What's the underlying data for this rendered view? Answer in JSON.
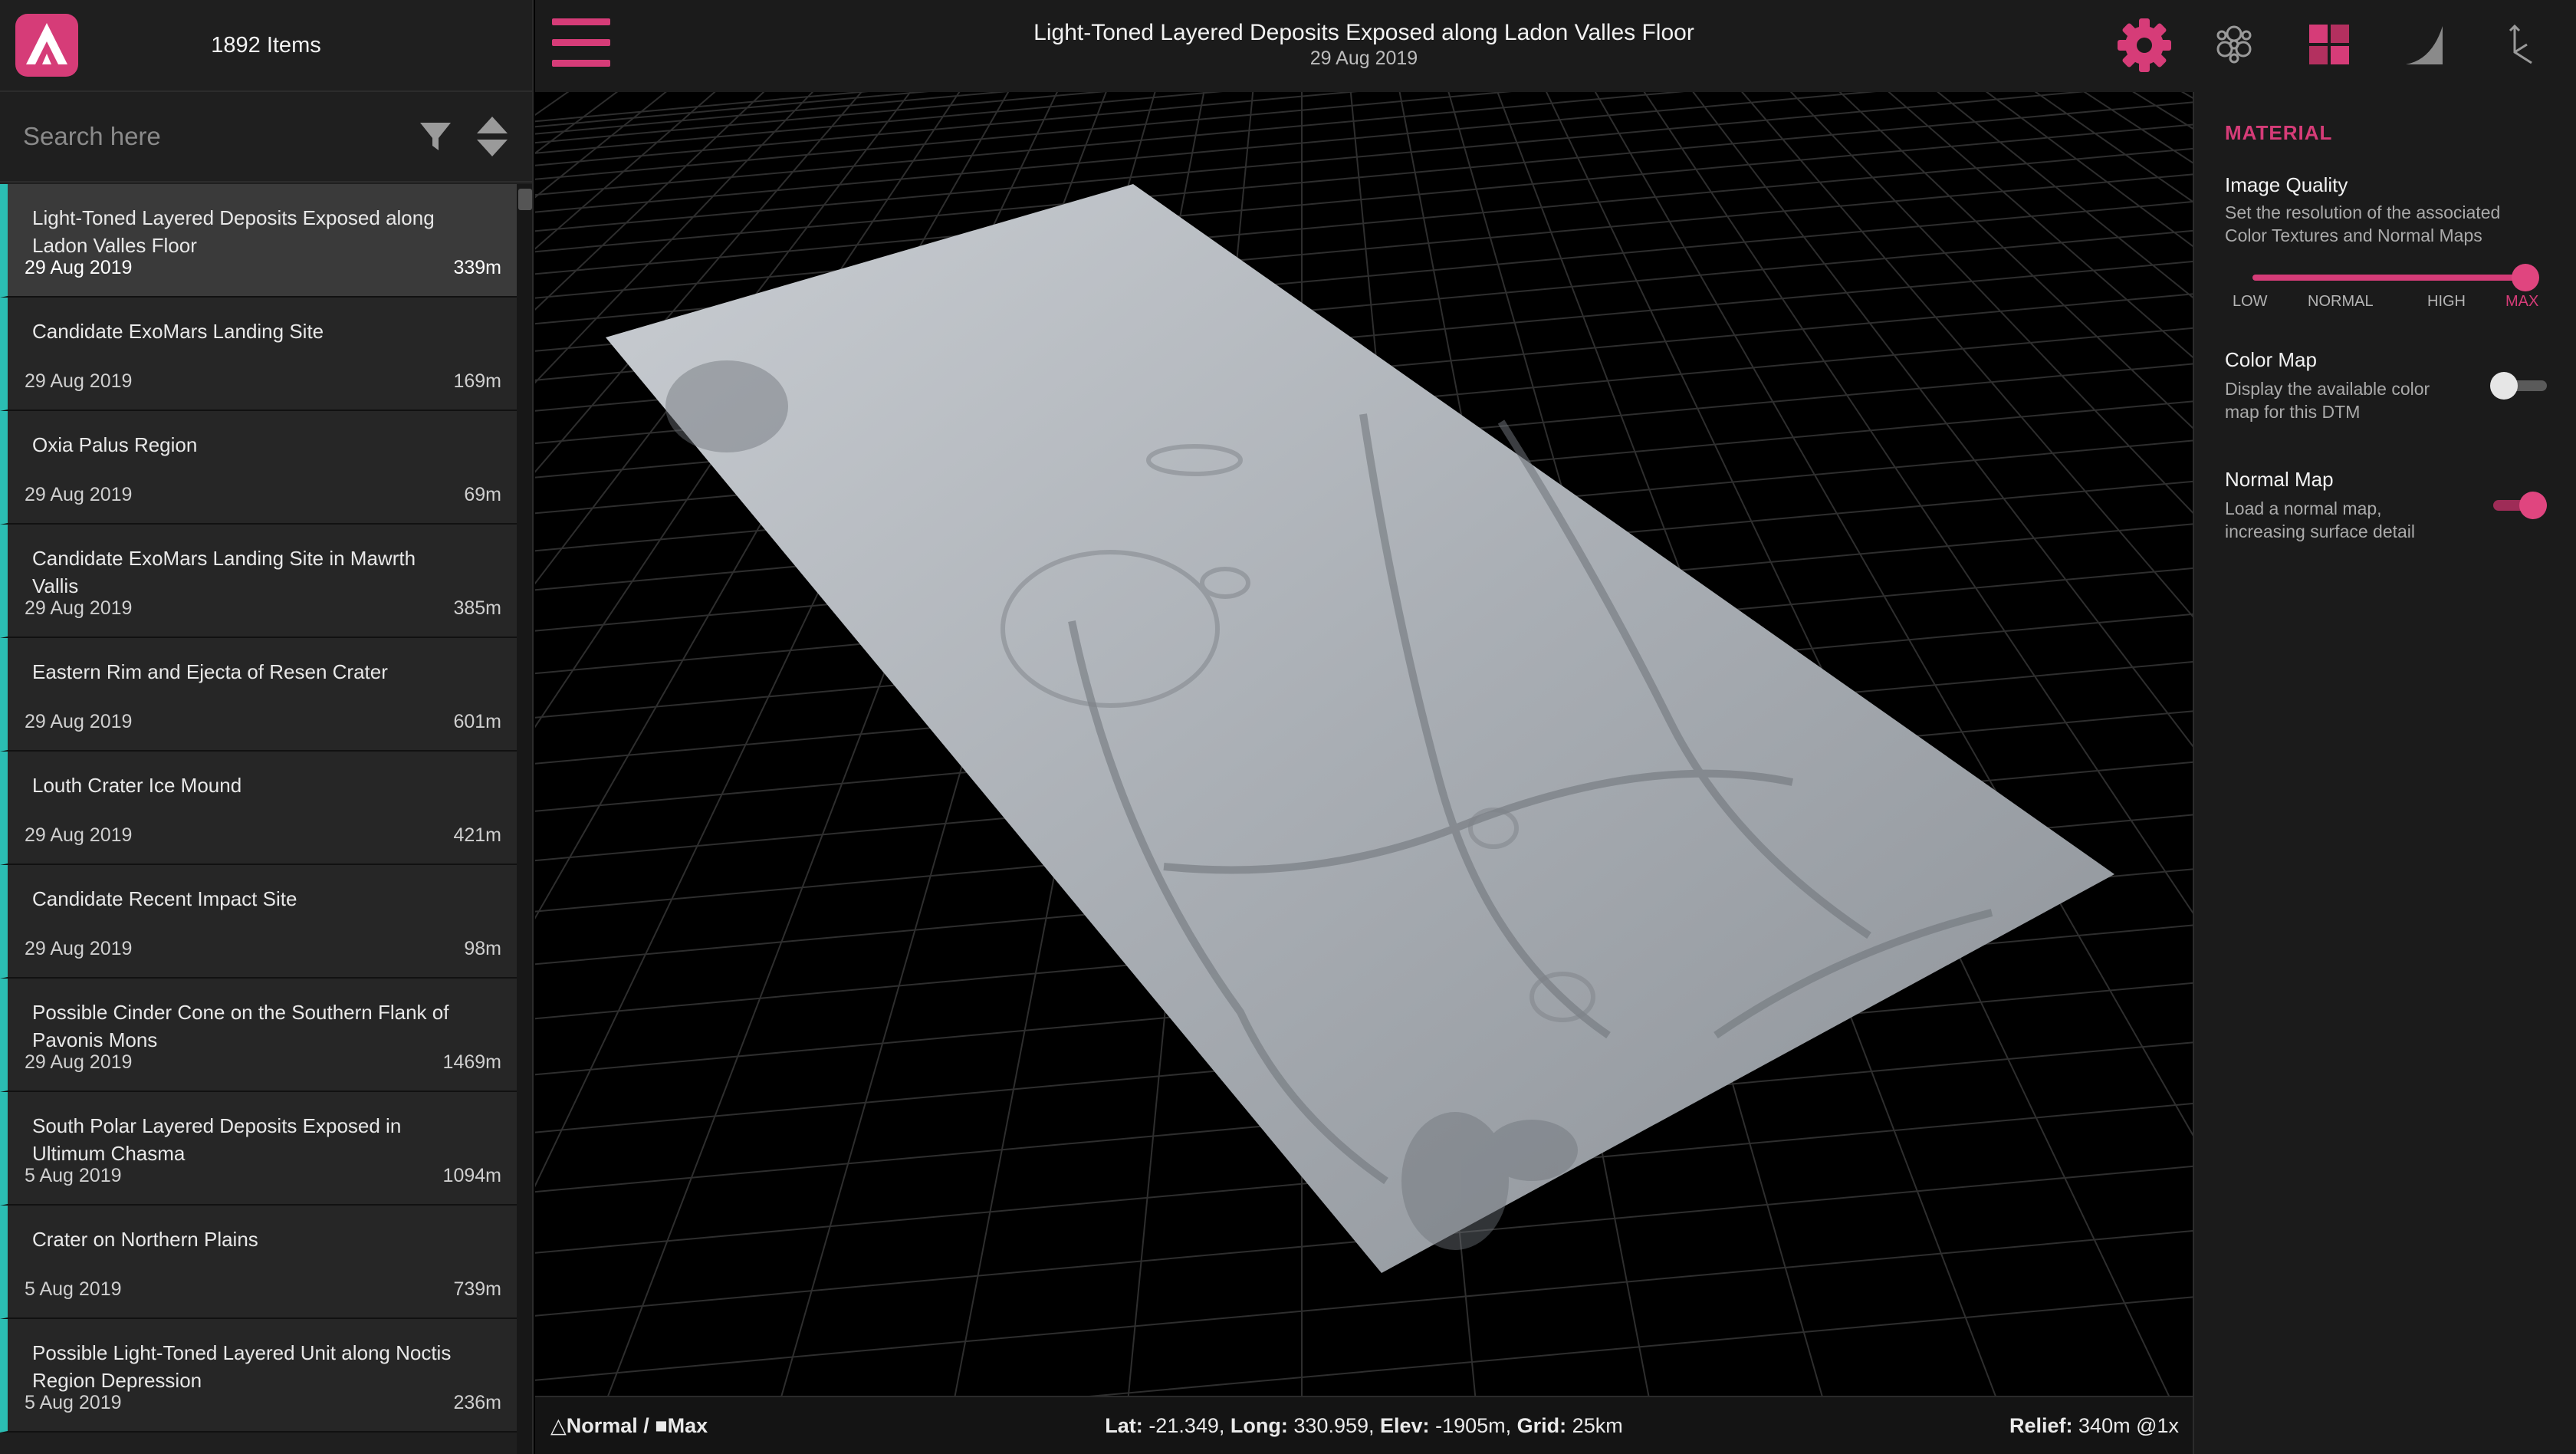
{
  "sidebar": {
    "item_count": "1892 Items",
    "search_placeholder": "Search here",
    "items": [
      {
        "title": "Light-Toned Layered Deposits Exposed along Ladon Valles Floor",
        "date": "29 Aug 2019",
        "size": "339m"
      },
      {
        "title": "Candidate ExoMars Landing Site",
        "date": "29 Aug 2019",
        "size": "169m"
      },
      {
        "title": "Oxia Palus Region",
        "date": "29 Aug 2019",
        "size": "69m"
      },
      {
        "title": "Candidate ExoMars Landing Site in Mawrth Vallis",
        "date": "29 Aug 2019",
        "size": "385m"
      },
      {
        "title": "Eastern Rim and Ejecta of Resen Crater",
        "date": "29 Aug 2019",
        "size": "601m"
      },
      {
        "title": "Louth Crater Ice Mound",
        "date": "29 Aug 2019",
        "size": "421m"
      },
      {
        "title": "Candidate Recent Impact Site",
        "date": "29 Aug 2019",
        "size": "98m"
      },
      {
        "title": "Possible Cinder Cone on the Southern Flank of Pavonis Mons",
        "date": "29 Aug 2019",
        "size": "1469m"
      },
      {
        "title": "South Polar Layered Deposits Exposed in Ultimum Chasma",
        "date": "5 Aug 2019",
        "size": "1094m"
      },
      {
        "title": "Crater on Northern Plains",
        "date": "5 Aug 2019",
        "size": "739m"
      },
      {
        "title": "Possible Light-Toned Layered Unit along Noctis Region Depression",
        "date": "5 Aug 2019",
        "size": "236m"
      }
    ]
  },
  "header": {
    "title": "Light-Toned Layered Deposits Exposed along Ladon Valles Floor",
    "date": "29 Aug 2019"
  },
  "status": {
    "mode_normal": "Normal",
    "mode_sep": " / ",
    "mode_max": "Max",
    "lat_label": "Lat:",
    "lat_value": "-21.349,",
    "long_label": "Long:",
    "long_value": "330.959,",
    "elev_label": "Elev:",
    "elev_value": "-1905m,",
    "grid_label": "Grid:",
    "grid_value": "25km",
    "relief_label": "Relief:",
    "relief_value": "340m @1x"
  },
  "panel": {
    "heading": "MATERIAL",
    "image_quality": {
      "title": "Image Quality",
      "desc": "Set the resolution of the associated Color Textures and Normal Maps",
      "levels": [
        "LOW",
        "NORMAL",
        "HIGH",
        "MAX"
      ],
      "selected": "MAX"
    },
    "color_map": {
      "title": "Color Map",
      "desc": "Display the available color map for this DTM",
      "enabled": false
    },
    "normal_map": {
      "title": "Normal Map",
      "desc": "Load a normal map, increasing surface detail",
      "enabled": true
    }
  },
  "colors": {
    "accent": "#d63c78",
    "list_marker": "#2bbdb3"
  },
  "icons": [
    "logo-icon",
    "filter-icon",
    "sort-icon",
    "menu-icon",
    "gear-icon",
    "cluster-icon",
    "layers-icon",
    "ramp-icon",
    "axes-icon"
  ]
}
